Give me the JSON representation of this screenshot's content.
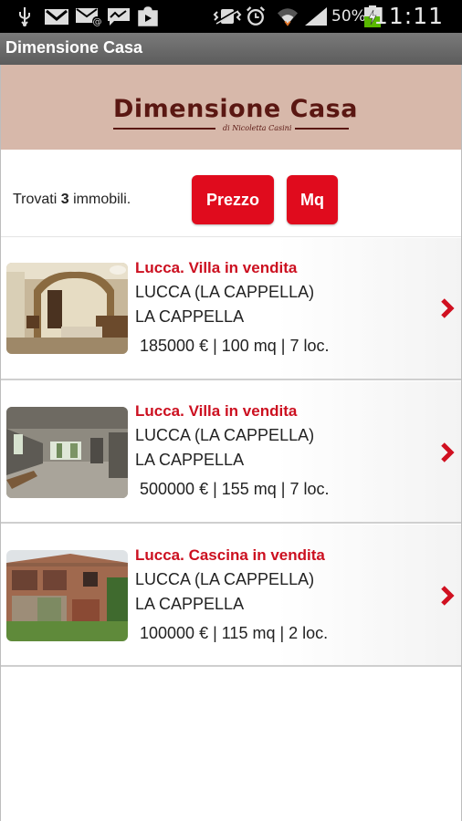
{
  "status_bar": {
    "battery": "50%",
    "time": "11:11",
    "icons": [
      "usb-icon",
      "gmail-icon",
      "mail-at-icon",
      "messaging-icon",
      "play-store-icon",
      "vibrate-icon",
      "alarm-icon",
      "wifi-icon",
      "signal-icon",
      "battery-charging-icon"
    ]
  },
  "app": {
    "title": "Dimensione Casa"
  },
  "logo": {
    "name": "Dimensione Casa",
    "sub": "di Nicoletta Casini"
  },
  "filter": {
    "found_prefix": "Trovati ",
    "found_count": "3",
    "found_suffix": " immobili.",
    "sort_price_label": "Prezzo",
    "sort_mq_label": "Mq"
  },
  "listings": [
    {
      "title": "Lucca. Villa in vendita",
      "location": "LUCCA (LA CAPPELLA)",
      "area": "LA CAPPELLA",
      "details": "185000 € | 100 mq | 7 loc."
    },
    {
      "title": "Lucca. Villa in vendita",
      "location": "LUCCA (LA CAPPELLA)",
      "area": "LA CAPPELLA",
      "details": "500000 € | 155 mq | 7 loc."
    },
    {
      "title": "Lucca. Cascina in vendita",
      "location": "LUCCA (LA CAPPELLA)",
      "area": "LA CAPPELLA",
      "details": "100000 € | 115 mq | 2 loc."
    }
  ],
  "colors": {
    "accent_red": "#e00b1d",
    "title_red": "#cc1020",
    "logo_brown": "#5a1712",
    "logo_band": "#d7b8aa"
  }
}
